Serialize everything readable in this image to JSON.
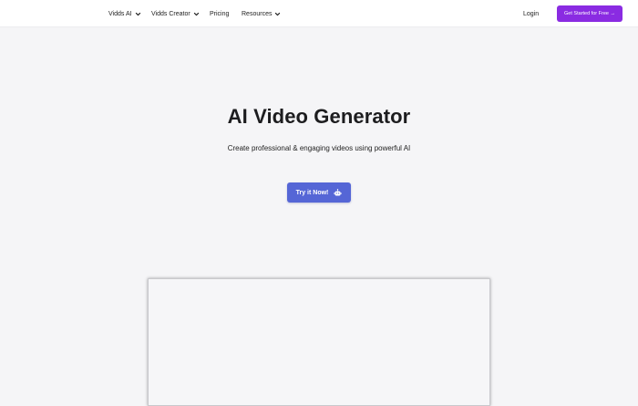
{
  "nav": {
    "items": [
      {
        "label": "Vidds AI",
        "has_dropdown": true
      },
      {
        "label": "Vidds Creator",
        "has_dropdown": true
      },
      {
        "label": "Pricing",
        "has_dropdown": false
      },
      {
        "label": "Resources",
        "has_dropdown": true
      }
    ],
    "login_label": "Login",
    "cta_label": "Get Started for Free →"
  },
  "hero": {
    "title": "AI Video Generator",
    "subtitle": "Create professional & engaging videos using powerful AI",
    "button_label": "Try it Now!",
    "button_icon": "robot-icon"
  },
  "colors": {
    "cta_purple": "#8a2be2",
    "button_blue": "#5566d6",
    "page_background": "#f5f5f7"
  }
}
